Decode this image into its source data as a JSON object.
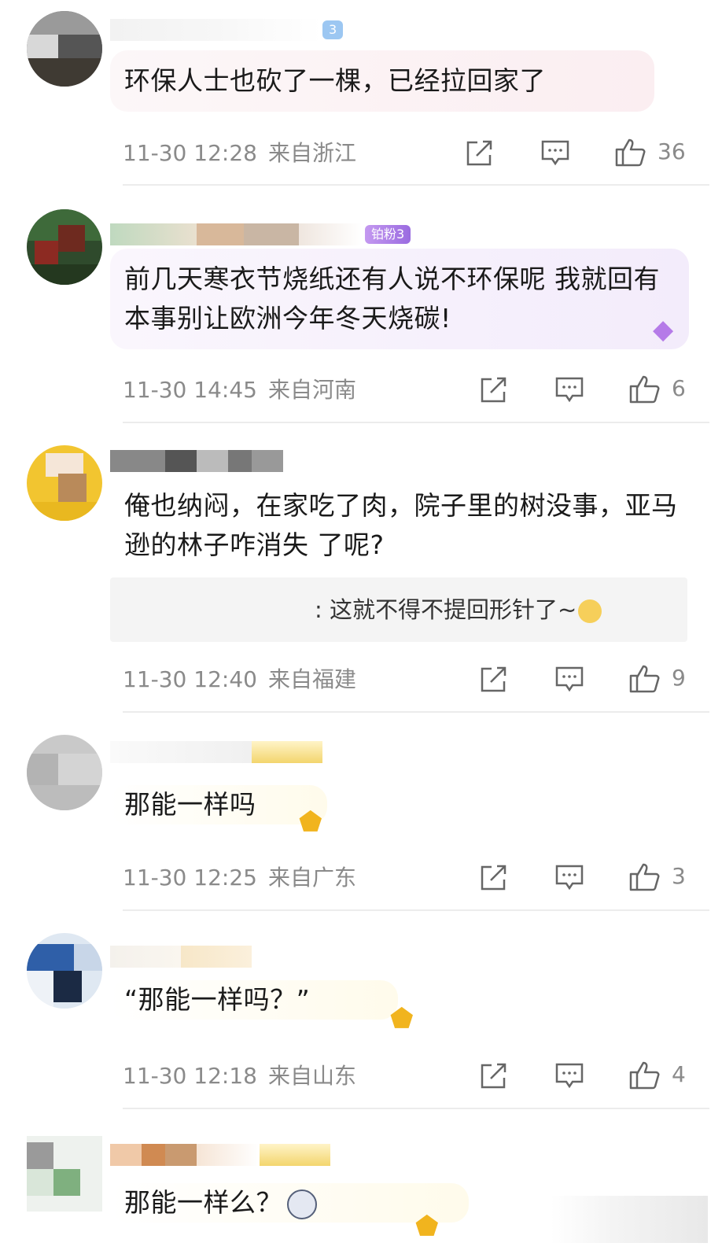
{
  "comments": [
    {
      "text": "环保人士也砍了一棵，已经拉回家了",
      "time": "11-30 12:28",
      "location": "来自浙江",
      "likes": "36",
      "badge": "3"
    },
    {
      "text": "前几天寒衣节烧纸还有人说不环保呢 我就回有本事别让欧洲今年冬天烧碳!",
      "time": "11-30 14:45",
      "location": "来自河南",
      "likes": "6",
      "badge": "铂粉3"
    },
    {
      "text": "俺也纳闷，在家吃了肉，院子里的树没事，亚马逊的林子咋消失 了呢?",
      "reply": ": 这就不得不提回形针了~",
      "time": "11-30 12:40",
      "location": "来自福建",
      "likes": "9"
    },
    {
      "text": "那能一样吗",
      "time": "11-30 12:25",
      "location": "来自广东",
      "likes": "3"
    },
    {
      "text": "“那能一样吗？”",
      "time": "11-30 12:18",
      "location": "来自山东",
      "likes": "4"
    },
    {
      "text": "那能一样么？"
    }
  ],
  "icons": {
    "share": "share-icon",
    "comment": "comment-icon",
    "like": "thumbs-up-icon"
  },
  "colors": {
    "meta_text": "#8a8a8a",
    "divider": "#ececec",
    "badge_blue": "#7cb7f0",
    "badge_purple": "#b277e8"
  }
}
